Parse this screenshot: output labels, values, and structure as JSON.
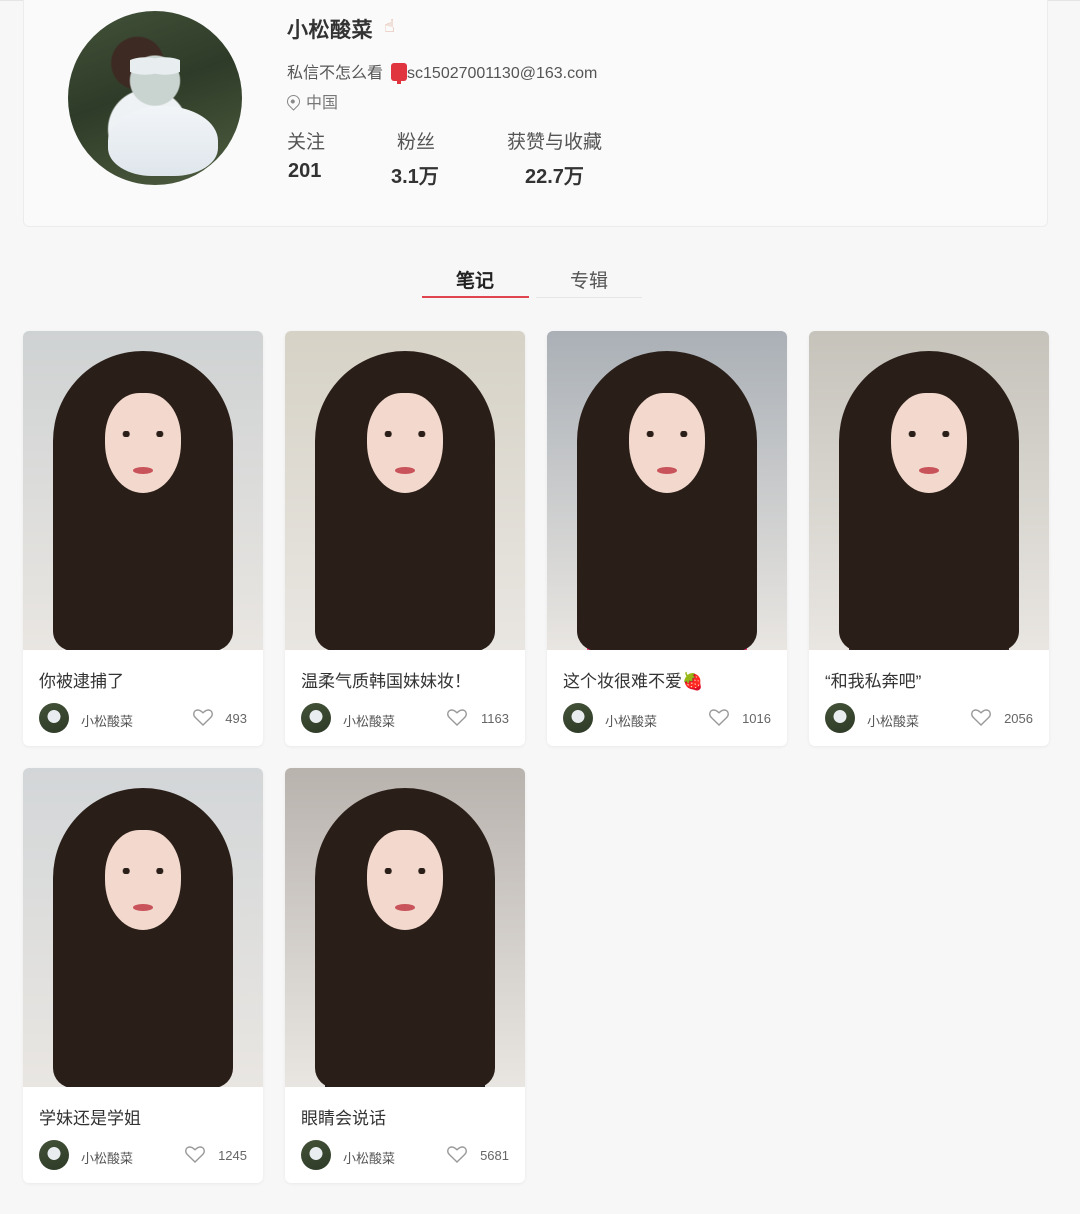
{
  "profile": {
    "username": "小松酸菜",
    "username_emoji": "☝",
    "bio_text": "私信不怎么看",
    "bio_email": "sc15027001130@163.com",
    "location": "中国",
    "stats": [
      {
        "label": "关注",
        "value": "201"
      },
      {
        "label": "粉丝",
        "value": "3.1万"
      },
      {
        "label": "获赞与收藏",
        "value": "22.7万"
      }
    ]
  },
  "tabs": [
    {
      "label": "笔记",
      "active": true
    },
    {
      "label": "专辑",
      "active": false
    }
  ],
  "notes": [
    {
      "title": "你被逮捕了",
      "author": "小松酸菜",
      "likes": "493",
      "bg": "#cfd2d3",
      "top_color": "#f2f2f0"
    },
    {
      "title": "温柔气质韩国妹妹妆！",
      "author": "小松酸菜",
      "likes": "1163",
      "bg": "#d6d2c6",
      "top_color": "#f2f0ec"
    },
    {
      "title": "这个妆很难不爱🍓",
      "author": "小松酸菜",
      "likes": "1016",
      "bg": "#aab0b6",
      "top_color": "#ec3a78"
    },
    {
      "title": "“和我私奔吧”",
      "author": "小松酸菜",
      "likes": "2056",
      "bg": "#c6c3bb",
      "top_color": "#3b2a2a"
    },
    {
      "title": "学妹还是学姐",
      "author": "小松酸菜",
      "likes": "1245",
      "bg": "#d3d6d8",
      "top_color": "#e8e8ea"
    },
    {
      "title": "眼睛会说话",
      "author": "小松酸菜",
      "likes": "5681",
      "bg": "#b9b3ae",
      "top_color": "#1f1f1f"
    }
  ],
  "icons": {
    "heart": "heart-icon",
    "pin": "location-pin-icon",
    "mail": "mailbox-icon"
  },
  "colors": {
    "accent": "#e0454f",
    "background": "#f7f7f7"
  }
}
